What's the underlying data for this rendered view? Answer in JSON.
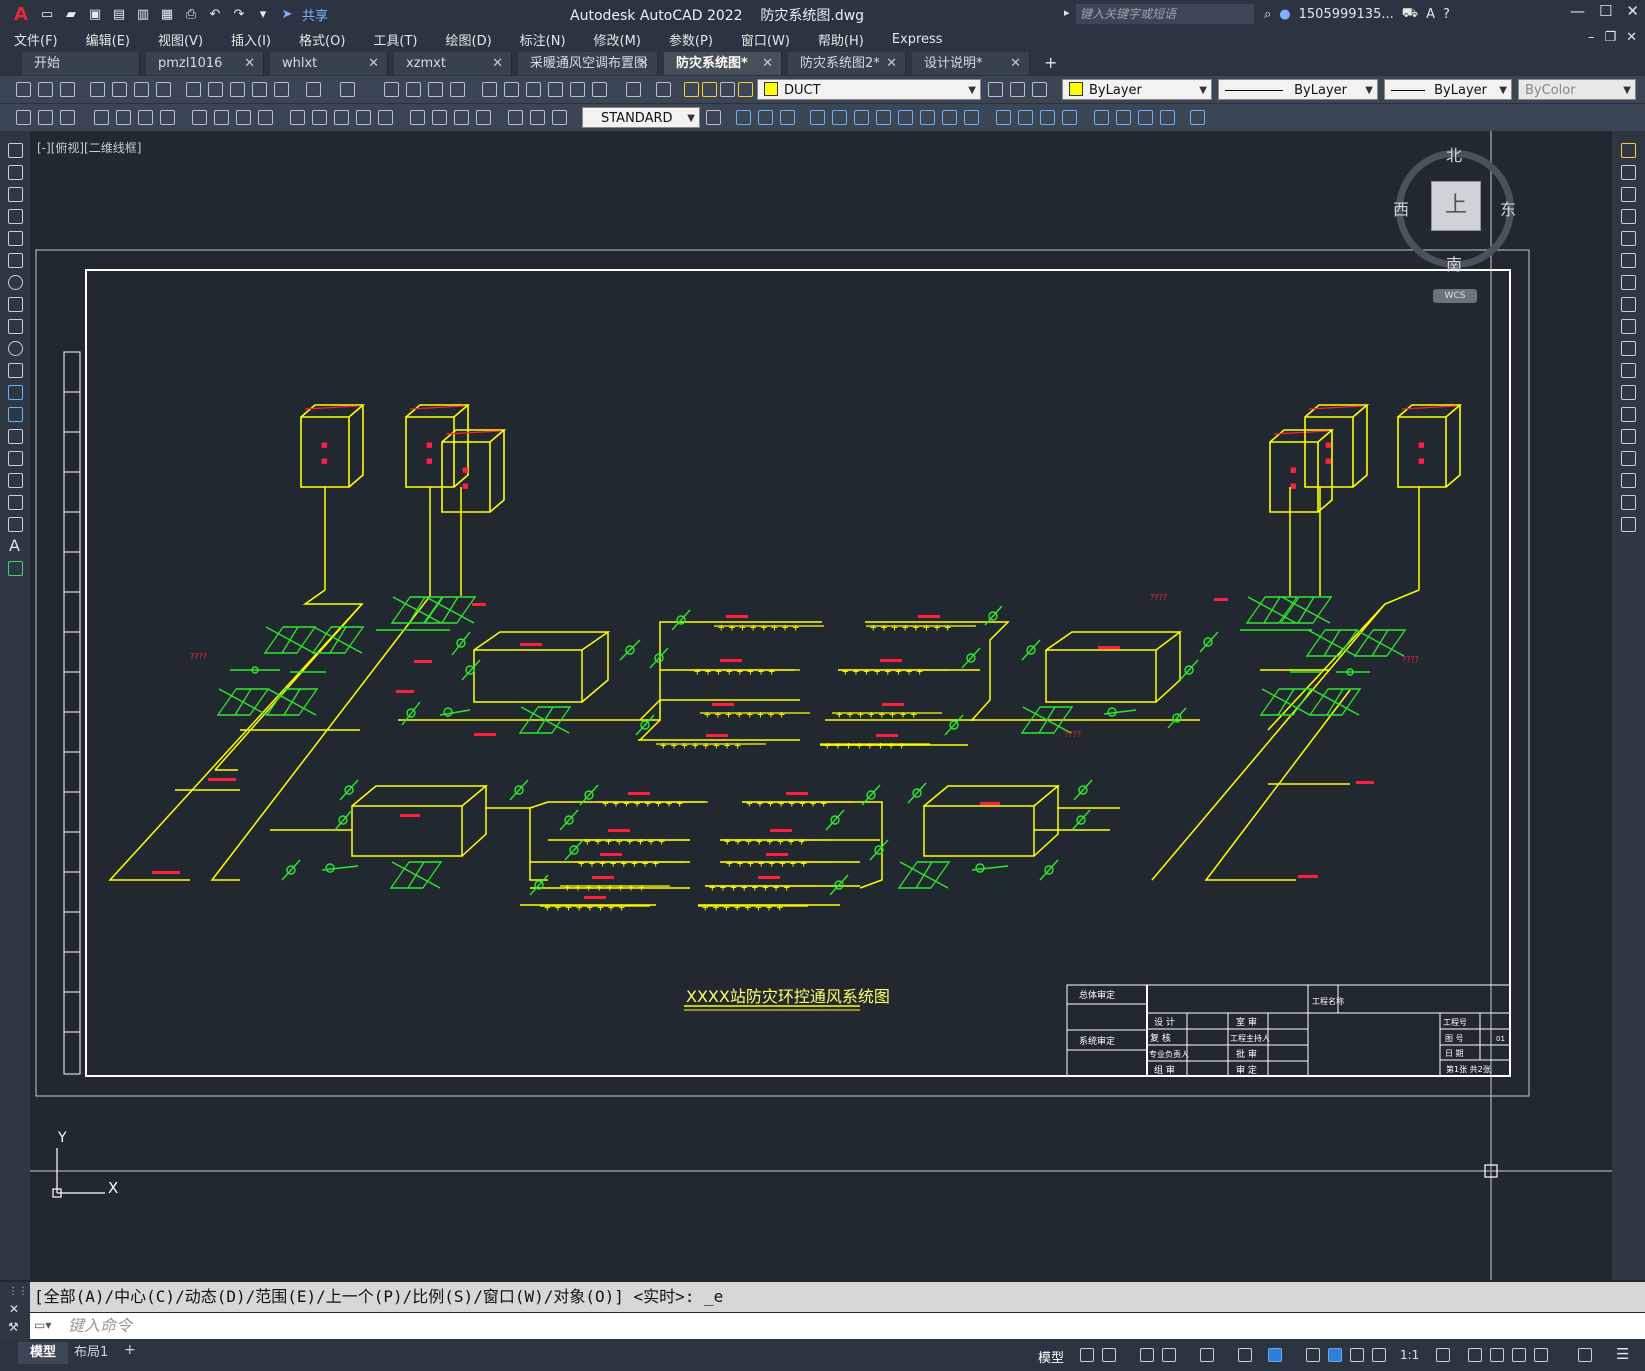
{
  "app": {
    "logo": "A",
    "title": "Autodesk AutoCAD 2022    防灾系统图.dwg",
    "share_label": "共享",
    "search_placeholder": "键入关键字或短语",
    "user": "1505999135...",
    "help": "?"
  },
  "menu": [
    "文件(F)",
    "编辑(E)",
    "视图(V)",
    "插入(I)",
    "格式(O)",
    "工具(T)",
    "绘图(D)",
    "标注(N)",
    "修改(M)",
    "参数(P)",
    "窗口(W)",
    "帮助(H)",
    "Express"
  ],
  "tabs": [
    {
      "label": "开始",
      "closable": false
    },
    {
      "label": "pmzl1016",
      "closable": true
    },
    {
      "label": "whlxt",
      "closable": true
    },
    {
      "label": "xzmxt",
      "closable": true
    },
    {
      "label": "采暖通风空调布置图",
      "closable": true
    },
    {
      "label": "防灾系统图*",
      "closable": true,
      "active": true
    },
    {
      "label": "防灾系统图2*",
      "closable": true
    },
    {
      "label": "设计说明*",
      "closable": true
    }
  ],
  "toolbar": {
    "layer": "DUCT",
    "color": "ByLayer",
    "linetype": "ByLayer",
    "lineweight": "ByLayer",
    "plotstyle": "ByColor",
    "textstyle": "STANDARD"
  },
  "viewport_label": "[-][俯视][二维线框]",
  "viewcube": {
    "north": "北",
    "south": "南",
    "east": "东",
    "west": "西",
    "face": "上",
    "wcs": "WCS"
  },
  "ucs": {
    "x": "X",
    "y": "Y"
  },
  "drawing": {
    "title": "XXXX站防灾环控通风系统图",
    "title_block": {
      "r1": "总体审定",
      "r2": "系统审定",
      "c_design": "设 计",
      "c_check": "复 核",
      "c_lead": "专业负责人",
      "c_group": "组 审",
      "c_review": "室 审",
      "c_chief": "工程主持人",
      "c_approve": "批 审",
      "c_audit": "审 定",
      "project_name": "工程名称",
      "project_no": "工程号",
      "drawing_no": "图 号",
      "date": "日 期",
      "sheet": "第1张 共2张",
      "sheet_no": "01"
    },
    "labels": {
      "q": "????",
      "p": "????"
    }
  },
  "command": {
    "history": "[全部(A)/中心(C)/动态(D)/范围(E)/上一个(P)/比例(S)/窗口(W)/对象(O)] <实时>: _e",
    "placeholder": "键入命令"
  },
  "status": {
    "layout_tabs": [
      "模型",
      "布局1"
    ],
    "model_button": "模型",
    "scale": "1:1"
  },
  "colors": {
    "accent": "#2f7fd8",
    "duct": "#ffff00",
    "valve": "#00ff00",
    "text_red": "#ff2040"
  }
}
